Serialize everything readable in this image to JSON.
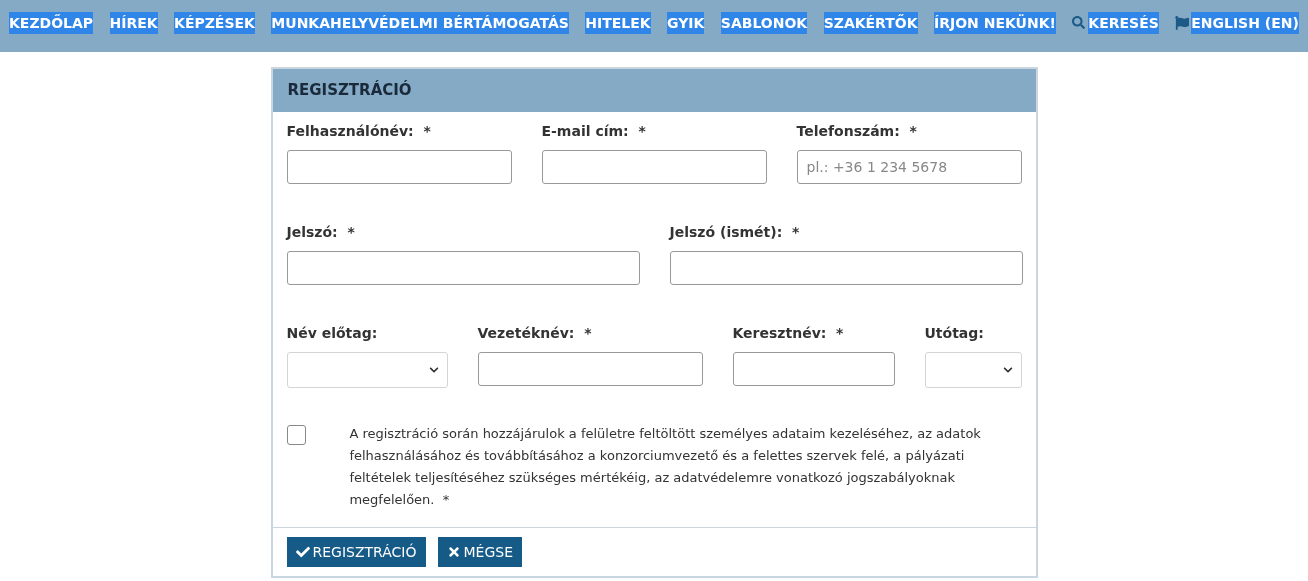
{
  "nav": [
    {
      "label": "KEZDŐLAP",
      "highlighted": true
    },
    {
      "label": "HÍREK",
      "highlighted": true
    },
    {
      "label": "KÉPZÉSEK",
      "highlighted": true
    },
    {
      "label": "MUNKAHELYVÉDELMI BÉRTÁMOGATÁS",
      "highlighted": true
    },
    {
      "label": "HITELEK",
      "highlighted": true
    },
    {
      "label": "GYIK",
      "highlighted": true
    },
    {
      "label": "SABLONOK",
      "highlighted": true
    },
    {
      "label": "SZAKÉRTŐK",
      "highlighted": true
    },
    {
      "label": "ÍRJON NEKÜNK!",
      "highlighted": true
    },
    {
      "label": "KERESÉS",
      "highlighted": true,
      "kind": "search"
    },
    {
      "label": "ENGLISH (EN)",
      "highlighted": true,
      "kind": "language"
    }
  ],
  "form": {
    "title": "REGISZTRÁCIÓ",
    "rows": [
      [
        {
          "label": "Felhasználónév:  *",
          "kind": "text"
        },
        {
          "label": "E-mail cím:  *",
          "kind": "text"
        },
        {
          "label": "Telefonszám:  *",
          "kind": "text",
          "placeholder": "pl.: +36 1 234 5678"
        }
      ],
      [
        {
          "label": "Jelszó:  *",
          "kind": "text"
        },
        {
          "label": "Jelszó (ismét):  *",
          "kind": "text"
        }
      ],
      [
        {
          "label": "Név előtag:",
          "kind": "select"
        },
        {
          "label": "Vezetéknév:  *",
          "kind": "text"
        },
        {
          "label": "Keresztnév:  *",
          "kind": "text"
        },
        {
          "label": "Utótag:",
          "kind": "select"
        }
      ]
    ],
    "consent": {
      "checked": false,
      "text": "A regisztráció során hozzájárulok a felületre feltöltött személyes adataim kezeléséhez, az adatok felhasználásához és továbbításához a konzorciumvezető és a felettes szervek felé, a pályázati feltételek teljesítéséhez szükséges mértékéig, az adatvédelemre vonatkozó jogszabályoknak megfelelően.  *"
    },
    "buttons": [
      {
        "label": "REGISZTRÁCIÓ",
        "kind": "submit"
      },
      {
        "label": "MÉGSE",
        "kind": "cancel"
      }
    ]
  }
}
